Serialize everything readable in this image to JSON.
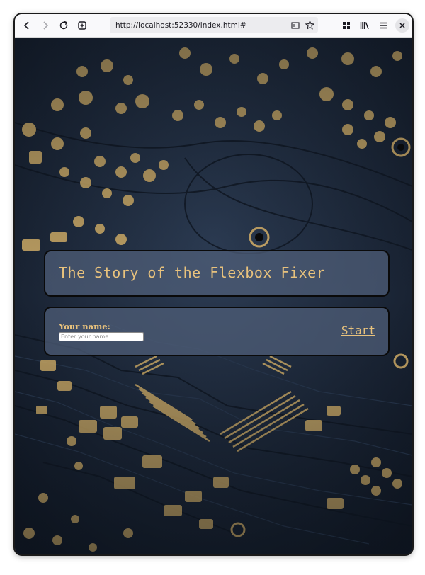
{
  "browser": {
    "url": "http://localhost:52330/index.html#",
    "back_icon": "back-arrow-icon",
    "forward_icon": "forward-arrow-icon",
    "reload_icon": "reload-icon",
    "new_tab_icon": "new-tab-icon",
    "reader_icon": "reader-view-icon",
    "bookmark_icon": "star-icon",
    "extensions_icon": "extensions-icon",
    "library_icon": "library-icon",
    "menu_icon": "hamburger-menu-icon",
    "close_icon": "close-icon"
  },
  "page": {
    "title": "The Story of the Flexbox Fixer",
    "form": {
      "name_label": "Your name:",
      "name_placeholder": "Enter your name",
      "name_value": "",
      "start_label": "Start"
    }
  },
  "colors": {
    "accent_text": "#e8c27d",
    "card_background": "#50607a",
    "card_border": "#0a0a0a",
    "board_background": "#1e2a3a",
    "solder_pad": "#d9b46a"
  }
}
